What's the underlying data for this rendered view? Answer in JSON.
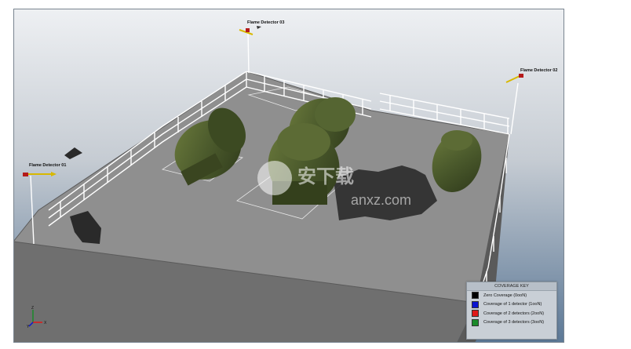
{
  "detectors": [
    {
      "label": "Flame Detector 01"
    },
    {
      "label": "Flame Detector 02"
    },
    {
      "label": "Flame Detector 03"
    }
  ],
  "coverage_key": {
    "title": "COVERAGE KEY",
    "items": [
      {
        "label": "Zero Coverage (0ooN)",
        "color": "#000000"
      },
      {
        "label": "Coverage of 1 detector (1ooN)",
        "color": "#0a14d0"
      },
      {
        "label": "Coverage of 2 detectors (2ooN)",
        "color": "#e01818"
      },
      {
        "label": "Coverage of 3 detectors (3ooN)",
        "color": "#1a8a2a"
      }
    ]
  },
  "axis": {
    "x": "X",
    "y": "Y",
    "z": "Z"
  },
  "watermark": {
    "text": "安下载",
    "domain": "anxz.com"
  },
  "colors": {
    "deck": "#8f8f8f",
    "tank": "#4b5a2c",
    "sky_top": "#eef0f3",
    "sky_bottom": "#5c7896"
  }
}
